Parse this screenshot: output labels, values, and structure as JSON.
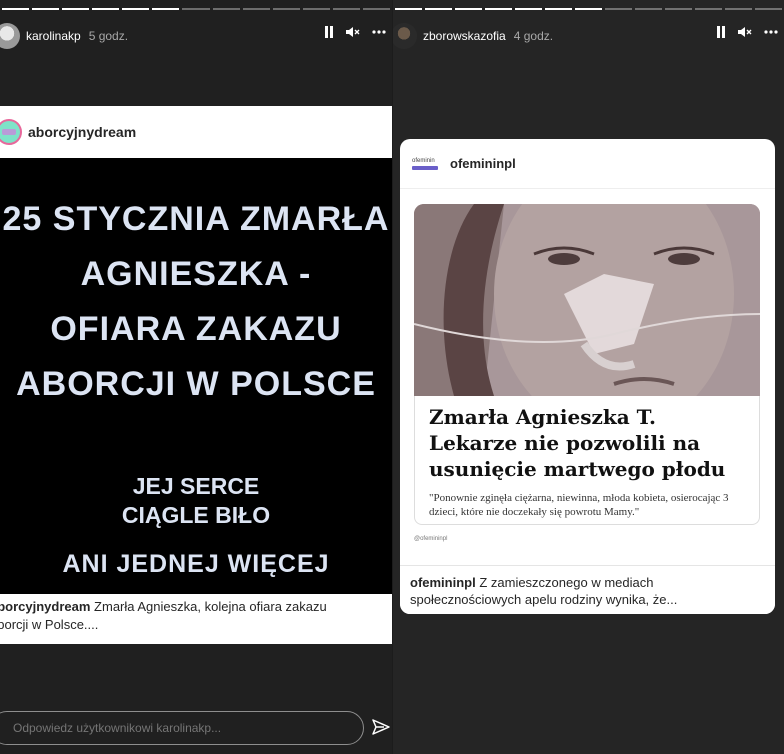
{
  "left_story": {
    "username": "karolinakp",
    "time": "5 godz.",
    "post": {
      "username": "aborcyjnydream",
      "headline_lines": [
        "25 STYCZNIA ZMARŁA",
        "AGNIESZKA -",
        "OFIARA ZAKAZU",
        "ABORCJI W POLSCE"
      ],
      "sub_lines": [
        "JEJ SERCE",
        "CIĄGLE BIŁO"
      ],
      "slogan": "ANI JEDNEJ WIĘCEJ",
      "caption_user": "aborcyjnydream",
      "caption_text": " Zmarła Agnieszka, kolejna ofiara zakazu",
      "caption_text2": "aborcji w Polsce...."
    },
    "reply_placeholder": "Odpowiedz użytkownikowi karolinakp..."
  },
  "right_story": {
    "username": "zborowskazofia",
    "time": "4 godz.",
    "post": {
      "username": "ofemininpl",
      "logo_text": "ofeminin",
      "news_title": "Zmarła Agnieszka T. Lekarze nie pozwolili na usunięcie martwego płodu",
      "news_quote": "\"Ponownie zginęła ciężarna, niewinna, młoda kobieta, osierocając 3 dzieci, które nie doczekały się powrotu Mamy.\"",
      "handle": "@ofemininpl",
      "caption_user": "ofemininpl",
      "caption_text": " Z zamieszczonego w mediach społecznościowych apelu rodziny wynika, że..."
    }
  },
  "icons": [
    "pause-icon",
    "mute-icon",
    "more-icon",
    "send-icon"
  ]
}
